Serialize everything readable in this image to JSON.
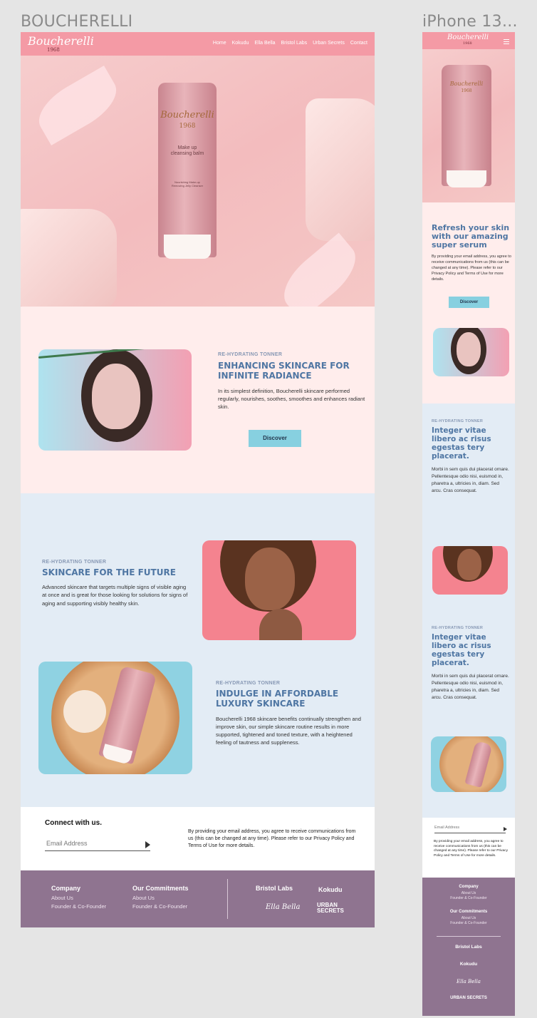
{
  "artboards": {
    "desktop": "BOUCHERELLI",
    "mobile": "iPhone 13..."
  },
  "brand": {
    "name": "Boucherelli",
    "year": "1968",
    "pink": "#f49aa5",
    "blue": "#4f76a3",
    "cyan": "#87d0e0",
    "footer": "#8f7490"
  },
  "nav": [
    "Home",
    "Kokudu",
    "Ella Bella",
    "Bristol Labs",
    "Urban Secrets",
    "Contact"
  ],
  "product": {
    "brand": "Boucherelli",
    "year": "1968",
    "line1": "Make up",
    "line2": "cleansing balm",
    "line3": "Nourishing Make-up",
    "line4": "Removing Jelly Cleanser"
  },
  "desktop": {
    "s1": {
      "eyebrow": "RE-HYDRATING TONNER",
      "heading1": "ENHANCING SKINCARE FOR",
      "heading2": "INFINITE RADIANCE",
      "body": "In its simplest definition, Boucherelli skincare performed regularly, nourishes, soothes, smoothes and enhances radiant skin.",
      "button": "Discover"
    },
    "s2": {
      "eyebrow": "RE-HYDRATING TONNER",
      "heading": "SKINCARE FOR THE FUTURE",
      "body": "Advanced skincare that targets multiple signs of visible aging at once and is great for those looking for solutions for signs of aging and supporting visibly healthy skin."
    },
    "s3": {
      "eyebrow": "RE-HYDRATING TONNER",
      "heading1": "INDULGE IN AFFORDABLE",
      "heading2": "LUXURY SKINCARE",
      "body": "Boucherelli 1968 skincare benefits continually strengthen and improve skin, our simple skincare routine results in more supported, tightened and toned texture, with a heightened feeling of tautness and suppleness."
    },
    "connect": {
      "title": "Connect with us.",
      "placeholder": "Email Address",
      "legal": "By providing your email address, you agree to receive communications from us (this can be changed at any time). Please refer to our Privacy Policy and Terms of Use for more details."
    }
  },
  "footer": {
    "company": {
      "title": "Company",
      "links": [
        "About Us",
        "Founder & Co-Founder"
      ]
    },
    "commit": {
      "title": "Our Commitments",
      "links": [
        "About Us",
        "Founder & Co-Founder"
      ]
    },
    "brands": [
      "Bristol Labs",
      "Kokudu",
      "Ella Bella",
      "URBAN SECRETS"
    ]
  },
  "mobile": {
    "hero": {
      "heading": "Refresh your skin with our amazing super serum",
      "body": "By providing your email address, you agree to receive communications from us (this can be changed at any time). Please refer to our Privacy Policy and Terms of Use for more details.",
      "button": "Discover"
    },
    "s1": {
      "eyebrow": "RE-HYDRATING TONNER",
      "heading": "Integer vitae libero ac risus egestas tery placerat.",
      "body": "Morbi in sem quis dui placerat ornare. Pellentesque odio nisi, euismod in, pharetra a, ultricies in, diam. Sed arcu. Cras consequat."
    },
    "s2": {
      "eyebrow": "RE-HYDRATING TONNER",
      "heading": "Integer vitae libero ac risus egestas tery placerat.",
      "body": "Morbi in sem quis dui placerat ornare. Pellentesque odio nisi, euismod in, pharetra a, ultricies in, diam. Sed arcu. Cras consequat."
    },
    "connect": {
      "placeholder": "Email Address",
      "legal": "By providing your email address, you agree to receive communications from us (this can be changed at any time). Please refer to our Privacy Policy and Terms of Use for more details."
    }
  }
}
